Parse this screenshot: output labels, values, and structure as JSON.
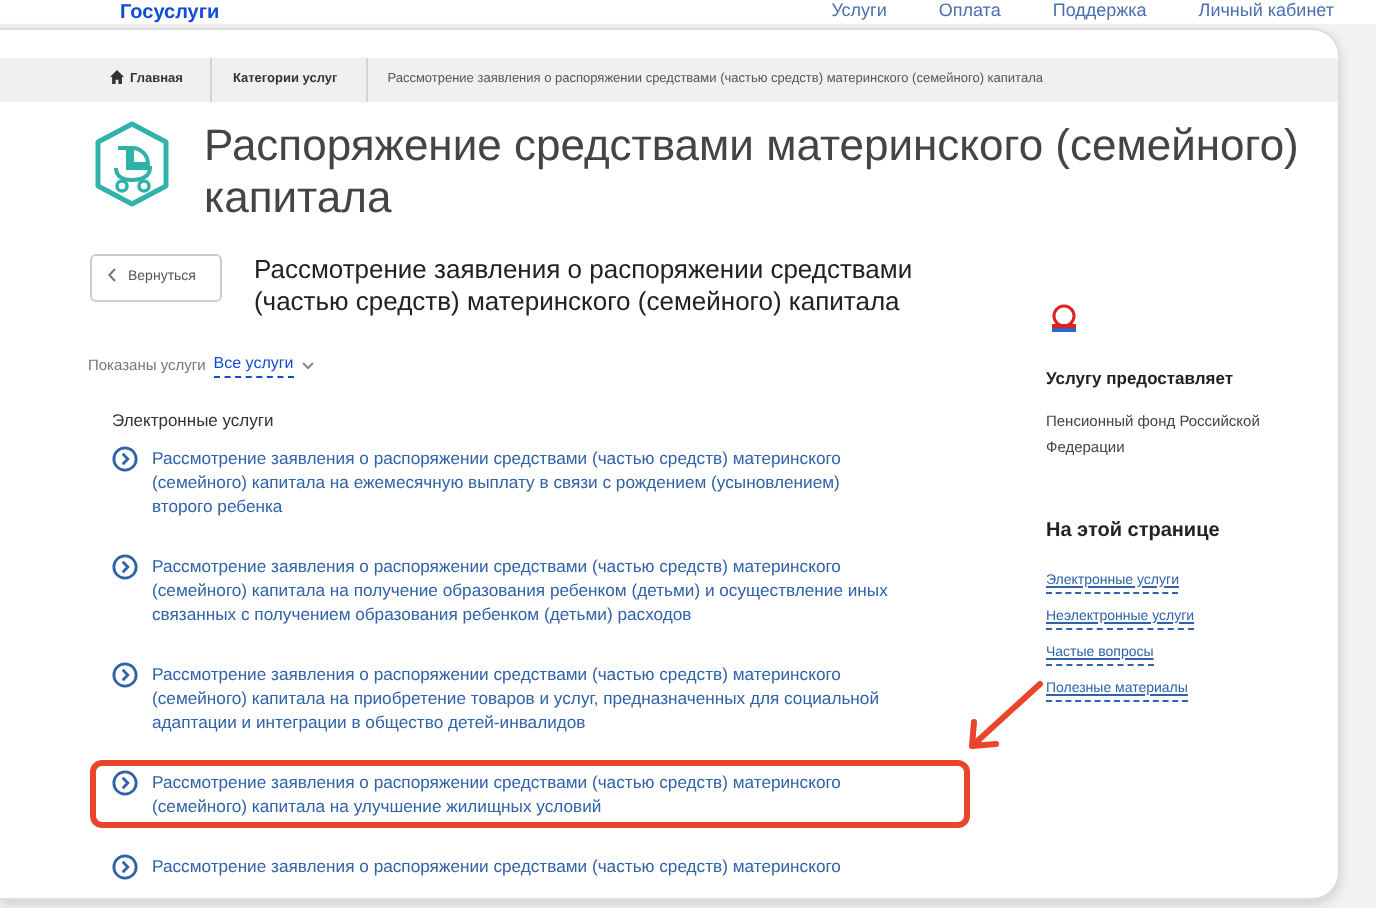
{
  "header": {
    "logo": "Госуслуги",
    "nav": [
      "Услуги",
      "Оплата",
      "Поддержка"
    ],
    "account": "Личный кабинет"
  },
  "breadcrumbs": [
    {
      "label": "Главная",
      "kind": "home"
    },
    {
      "label": "Категории услуг",
      "kind": "link"
    },
    {
      "label": "Рассмотрение заявления о распоряжении средствами (частью средств) материнского (семейного) капитала",
      "kind": "current"
    }
  ],
  "page_title": "Распоряжение средствами материнского (семейного) капитала",
  "back_button": "Вернуться",
  "subtitle": "Рассмотрение заявления о распоряжении средствами (частью средств) материнского (семейного) капитала",
  "filter": {
    "label": "Показаны услуги",
    "value": "Все услуги"
  },
  "section_title": "Электронные услуги",
  "services": [
    {
      "text": "Рассмотрение заявления о распоряжении средствами (частью средств) материнского (семейного) капитала на ежемесячную выплату в связи с рождением (усыновлением) второго ребенка",
      "highlighted": false
    },
    {
      "text": "Рассмотрение заявления о распоряжении средствами (частью средств) материнского (семейного) капитала на получение образования ребенком (детьми) и осуществление иных связанных с получением образования ребенком (детьми) расходов",
      "highlighted": false
    },
    {
      "text": "Рассмотрение заявления о распоряжении средствами (частью средств) материнского (семейного) капитала на приобретение товаров и услуг, предназначенных для социальной адаптации и интеграции в общество детей-инвалидов",
      "highlighted": false
    },
    {
      "text": "Рассмотрение заявления о распоряжении средствами (частью средств) материнского (семейного) капитала на улучшение жилищных условий",
      "highlighted": true
    },
    {
      "text": "Рассмотрение заявления о распоряжении средствами (частью средств) материнского",
      "highlighted": false
    }
  ],
  "sidebar": {
    "provider_title": "Услугу предоставляет",
    "provider": "Пенсионный фонд Российской Федерации",
    "toc_title": "На этой странице",
    "toc": [
      "Электронные услуги",
      "Неэлектронные услуги",
      "Частые вопросы",
      "Полезные материалы"
    ]
  }
}
